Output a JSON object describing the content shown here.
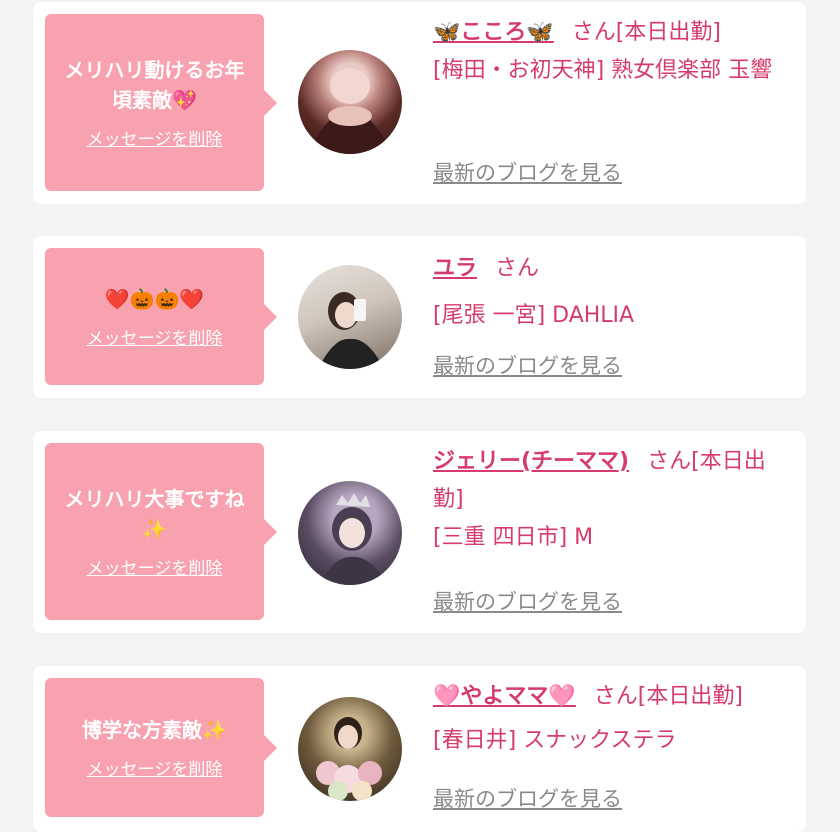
{
  "colors": {
    "accent": "#d63c6b",
    "bubble": "#f8a2b0",
    "card": "#ffffff",
    "page": "#f3f3f3",
    "link_grey": "#8a8a8a"
  },
  "entries": [
    {
      "message": "メリハリ動けるお年頃素敵💖",
      "delete_label": "メッセージを削除",
      "name": "🦋こころ🦋",
      "honorific": "さん[本日出勤]",
      "shop": "[梅田・お初天神] 熟女倶楽部 玉響",
      "blog_label": "最新のブログを見る"
    },
    {
      "message": "❤️🎃🎃❤️",
      "delete_label": "メッセージを削除",
      "name": "ユラ",
      "honorific": "さん",
      "shop": "[尾張 一宮] DAHLIA",
      "blog_label": "最新のブログを見る"
    },
    {
      "message": "メリハリ大事ですね✨",
      "delete_label": "メッセージを削除",
      "name": "ジェリー(チーママ)",
      "honorific": "さん[本日出勤]",
      "shop": "[三重 四日市] M",
      "blog_label": "最新のブログを見る"
    },
    {
      "message": "博学な方素敵✨",
      "delete_label": "メッセージを削除",
      "name": "🩷やよママ🩷",
      "honorific": "さん[本日出勤]",
      "shop": "[春日井] スナックステラ",
      "blog_label": "最新のブログを見る"
    }
  ]
}
